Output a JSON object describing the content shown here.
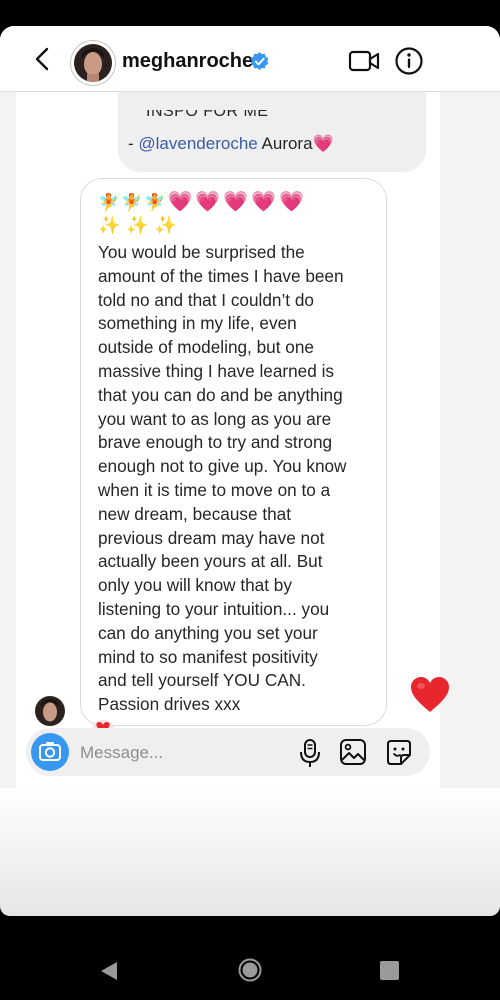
{
  "header": {
    "username": "meghanroche",
    "back_icon": "chevron-left-icon",
    "verified_icon": "verified-badge-icon",
    "video_icon": "video-call-icon",
    "info_icon": "info-icon"
  },
  "previous_message": {
    "top_fragment": "INSPO FOR ME",
    "dash": "- ",
    "mention": "@lavenderoche",
    "trailing": " Aurora💗"
  },
  "message": {
    "emoji_line_1": {
      "fairies": "🧚🧚🧚",
      "hearts": "💗💗💗💗💗"
    },
    "emoji_line_2": "✨✨✨",
    "lines": [
      "You would be surprised the",
      "amount of the times I have been",
      "told no and that I couldn’t do",
      "something in my life, even",
      "outside of modeling, but one",
      "massive thing I have learned is",
      "that you can do and be anything",
      "you want to as long as you are",
      "brave enough to try and strong",
      "enough not to give up. You know",
      "when it is time to move on to a",
      "new dream, because that",
      "previous dream may have not",
      "actually been yours at all. But",
      "only you will know that by",
      "listening to your intuition... you",
      "can do anything you set your",
      "mind to so manifest positivity",
      "and tell yourself YOU CAN.",
      "Passion drives xxx"
    ]
  },
  "reaction": {
    "icon": "heart-icon",
    "color": "#e8262d"
  },
  "composer": {
    "placeholder": "Message...",
    "camera_icon": "camera-icon",
    "mic_icon": "microphone-icon",
    "gallery_icon": "gallery-icon",
    "sticker_icon": "sticker-icon",
    "accent": "#3897f0"
  },
  "navbar": {
    "back_icon": "nav-back-icon",
    "home_icon": "nav-home-icon",
    "recent_icon": "nav-recents-icon"
  }
}
